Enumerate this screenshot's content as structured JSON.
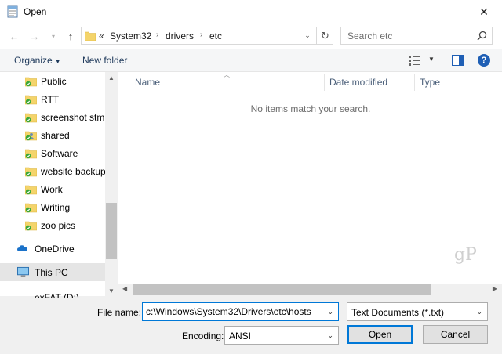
{
  "window": {
    "title": "Open",
    "close_glyph": "✕"
  },
  "address": {
    "overflow": "«",
    "crumbs": [
      "System32",
      "drivers",
      "etc"
    ],
    "separator": "›"
  },
  "search": {
    "placeholder": "Search etc"
  },
  "toolbar": {
    "organize_label": "Organize",
    "new_folder_label": "New folder",
    "help_label": "?"
  },
  "nav": {
    "items": [
      {
        "label": "Public"
      },
      {
        "label": "RTT"
      },
      {
        "label": "screenshot stmp"
      },
      {
        "label": "shared"
      },
      {
        "label": "Software"
      },
      {
        "label": "website backups"
      },
      {
        "label": "Work"
      },
      {
        "label": "Writing"
      },
      {
        "label": "zoo pics"
      }
    ],
    "onedrive_label": "OneDrive",
    "thispc_label": "This PC",
    "partial_label": "exFAT (D:)"
  },
  "columns": {
    "name": "Name",
    "date_modified": "Date modified",
    "type": "Type"
  },
  "file_list": {
    "empty_message": "No items match your search."
  },
  "watermark": "gP",
  "bottom": {
    "file_name_label": "File name:",
    "file_name_value": "c:\\Windows\\System32\\Drivers\\etc\\hosts",
    "file_type_value": "Text Documents (*.txt)",
    "encoding_label": "Encoding:",
    "encoding_value": "ANSI",
    "open_label": "Open",
    "cancel_label": "Cancel"
  },
  "colors": {
    "accent": "#0078d7",
    "folder": "#f4d46b",
    "sync_check": "#3aa83a"
  }
}
